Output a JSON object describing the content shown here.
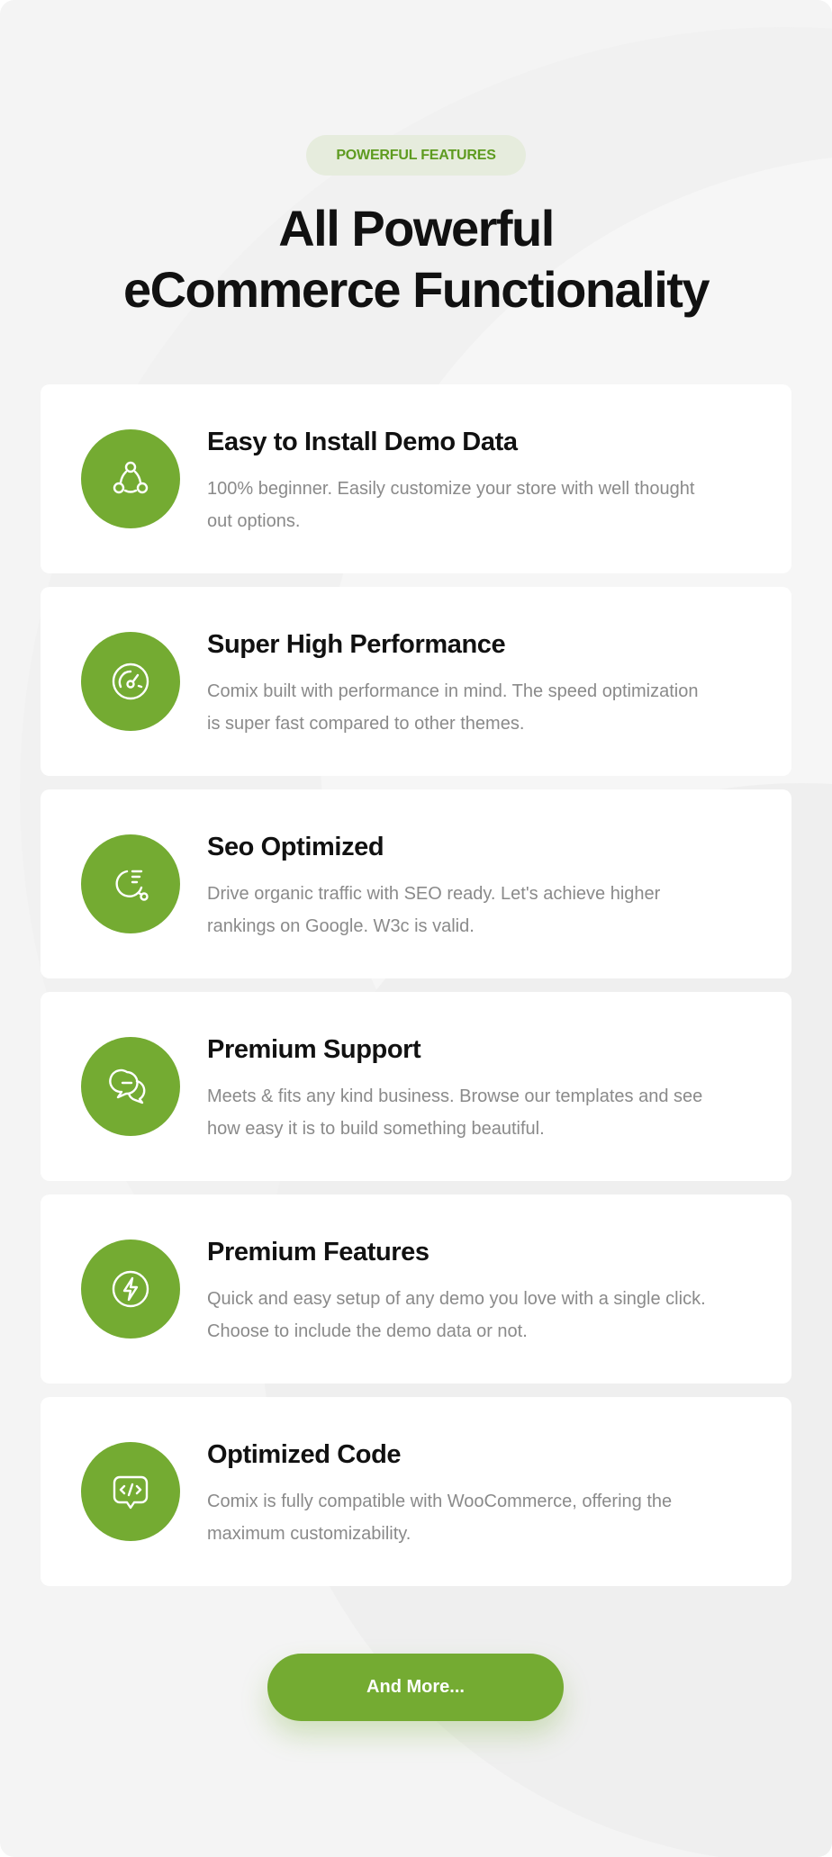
{
  "header": {
    "tag": "POWERFUL FEATURES",
    "headline_line1": "All Powerful",
    "headline_line2": "eCommerce Functionality"
  },
  "features": [
    {
      "title": "Easy to Install Demo Data",
      "line1": "100% beginner. Easily customize your store with well thought",
      "line2": "out options.",
      "icon": "network-nodes-icon"
    },
    {
      "title": "Super High Performance",
      "line1": "Comix built with performance in mind. The speed optimization",
      "line2": "is super fast compared to other themes.",
      "icon": "speedometer-icon"
    },
    {
      "title": "Seo Optimized",
      "line1": "Drive organic traffic with SEO ready. Let's achieve higher",
      "line2": "rankings on Google. W3c is valid.",
      "icon": "seo-chart-icon"
    },
    {
      "title": "Premium Support",
      "line1": "Meets & fits any kind business. Browse our templates and see",
      "line2": "how easy it is to build something beautiful.",
      "icon": "chat-bubbles-icon"
    },
    {
      "title": "Premium Features",
      "line1": "Quick and easy setup of any demo you love with a single click.",
      "line2": "Choose to include the demo data or not.",
      "icon": "lightning-icon"
    },
    {
      "title": "Optimized Code",
      "line1": "Comix is fully compatible with WooCommerce, offering the",
      "line2": "maximum customizability.",
      "icon": "code-bubble-icon"
    }
  ],
  "cta": {
    "label": "And More..."
  },
  "colors": {
    "accent": "#74ab32",
    "tag_bg": "#e6ecdd",
    "tag_text": "#5e9b20",
    "heading": "#111111",
    "body_text": "#8a8a8a",
    "page_bg": "#f4f4f4",
    "card_bg": "#ffffff"
  }
}
